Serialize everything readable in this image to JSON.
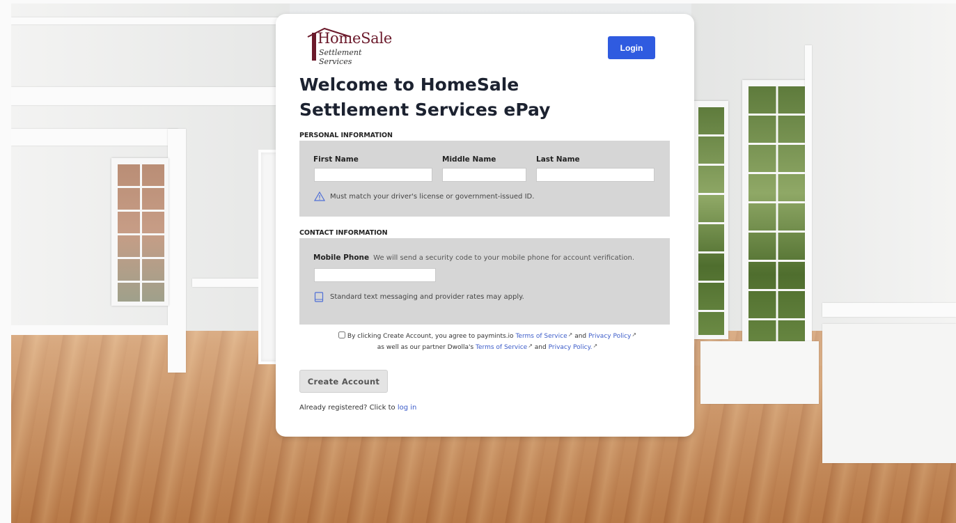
{
  "brand": {
    "name": "HomeSale",
    "subtitle": "Settlement Services",
    "color": "#6b1a2b"
  },
  "header": {
    "login_label": "Login"
  },
  "page_title": "Welcome to HomeSale Settlement Services ePay",
  "personal": {
    "section_label": "PERSONAL INFORMATION",
    "first_name_label": "First Name",
    "middle_name_label": "Middle Name",
    "last_name_label": "Last Name",
    "first_name_value": "",
    "middle_name_value": "",
    "last_name_value": "",
    "id_note": "Must match your driver's license or government-issued ID.",
    "id_note_icon": "warning-triangle-icon"
  },
  "contact": {
    "section_label": "CONTACT INFORMATION",
    "mobile_label": "Mobile Phone",
    "mobile_helper": "We will send a security code to your mobile phone for account verification.",
    "mobile_value": "",
    "rates_note": "Standard text messaging and provider rates may apply.",
    "rates_note_icon": "mobile-phone-icon"
  },
  "agreement": {
    "text_1": "By clicking Create Account, you agree to paymints.io",
    "tos_link_1": "Terms of Service",
    "and_1": "and",
    "privacy_link_1": "Privacy Policy",
    "text_2": "as well as our partner Dwolla's",
    "tos_link_2": "Terms of Service",
    "and_2": "and",
    "privacy_link_2": "Privacy Policy.",
    "external_icon": "external-link-icon",
    "checked": false
  },
  "create_account_label": "Create Account",
  "footer": {
    "already_text": "Already registered? Click to",
    "login_link": "log in"
  },
  "colors": {
    "accent": "#2f5be0",
    "link": "#3c5cc9",
    "panel": "#d6d6d6"
  }
}
